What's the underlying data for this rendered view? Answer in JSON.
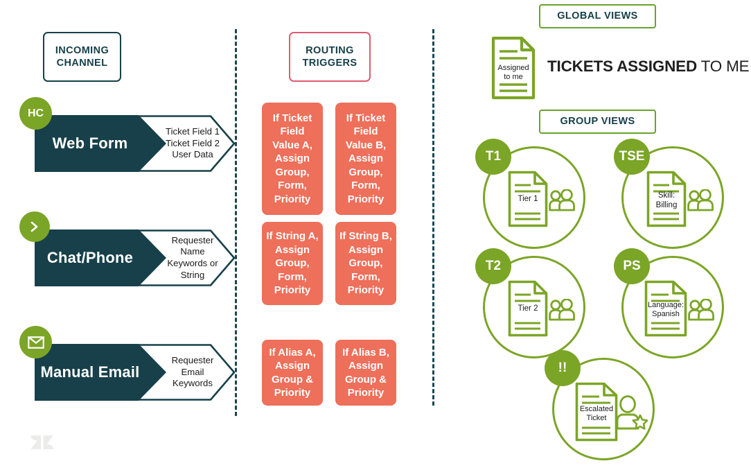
{
  "colors": {
    "dark_teal": "#17404a",
    "green": "#7ba526",
    "green_outline": "#6aa22b",
    "coral": "#ee6f5a",
    "pink_border": "#e05a72"
  },
  "columns": {
    "incoming_channel": {
      "header": "INCOMING CHANNEL",
      "rows": [
        {
          "badge": "HC",
          "badge_icon": "help-center-badge",
          "label": "Web Form",
          "detail": "Ticket Field 1\nTicket Field 2\nUser Data"
        },
        {
          "badge": "›",
          "badge_icon": "chevron-right-icon",
          "label": "Chat/Phone",
          "detail": "Requester\nName\nKeywords or\nString"
        },
        {
          "badge": "✉",
          "badge_icon": "envelope-icon",
          "label": "Manual Email",
          "detail": "Requester\nEmail\nKeywords"
        }
      ]
    },
    "routing_triggers": {
      "header": "ROUTING TRIGGERS",
      "cards": [
        {
          "text": "If Ticket Field Value A, Assign Group, Form, Priority"
        },
        {
          "text": "If Ticket Field Value B, Assign Group, Form, Priority"
        },
        {
          "text": "If String A, Assign Group, Form, Priority"
        },
        {
          "text": "If String B, Assign Group, Form, Priority"
        },
        {
          "text": "If Alias A, Assign Group & Priority"
        },
        {
          "text": "If Alias B, Assign Group & Priority"
        }
      ]
    },
    "views": {
      "global_views_header": "GLOBAL VIEWS",
      "group_views_header": "GROUP VIEWS",
      "global_view": {
        "doc_label": "Assigned\nto me",
        "title_bold": "TICKETS ASSIGNED",
        "title_normal": " TO ME"
      },
      "groups": [
        {
          "badge": "T1",
          "doc_label": "Tier 1",
          "people": "two-people"
        },
        {
          "badge": "TSE",
          "doc_label": "Skill:\nBilling",
          "people": "two-people"
        },
        {
          "badge": "T2",
          "doc_label": "Tier 2",
          "people": "two-people"
        },
        {
          "badge": "PS",
          "doc_label": "Language:\nSpanish",
          "people": "two-people"
        },
        {
          "badge": "!!",
          "doc_label": "Escalated\nTicket",
          "people": "person-star"
        }
      ]
    }
  },
  "footer": {
    "logo": "zendesk-logo"
  }
}
